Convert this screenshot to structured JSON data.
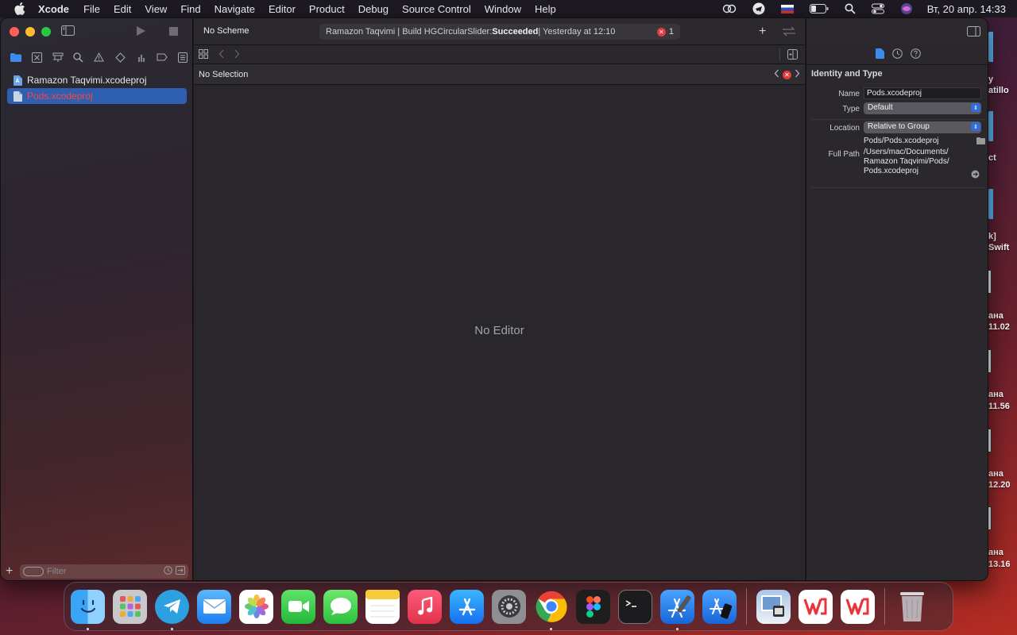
{
  "menubar": {
    "app": "Xcode",
    "items": [
      "File",
      "Edit",
      "View",
      "Find",
      "Navigate",
      "Editor",
      "Product",
      "Debug",
      "Source Control",
      "Window",
      "Help"
    ],
    "clock": "Вт, 20 апр.  14:33"
  },
  "desktop_labels": [
    "y",
    "atillo",
    "ct",
    "k]",
    "Swift",
    "ана",
    "11.02",
    "ана",
    "11.56",
    "ана",
    "12.20",
    "ана",
    "13.16"
  ],
  "navigator": {
    "items": [
      {
        "label": "Ramazon Taqvimi.xcodeproj"
      },
      {
        "label": "Pods.xcodeproj"
      }
    ],
    "filter_placeholder": "Filter"
  },
  "toolbar": {
    "scheme": "No Scheme",
    "activity_prefix": "Ramazon Taqvimi | Build HGCircularSlider: ",
    "activity_status": "Succeeded",
    "activity_time": " | Yesterday at 12:10",
    "error_count": "1"
  },
  "editor": {
    "jump_selection": "No Selection",
    "placeholder": "No Editor"
  },
  "inspector": {
    "section_title": "Identity and Type",
    "name_label": "Name",
    "name_value": "Pods.xcodeproj",
    "type_label": "Type",
    "type_value": "Default",
    "location_label": "Location",
    "location_value": "Relative to Group",
    "location_path": "Pods/Pods.xcodeproj",
    "fullpath_label": "Full Path",
    "fullpath_line1": "/Users/mac/Documents/",
    "fullpath_line2": "Ramazon Taqvimi/Pods/",
    "fullpath_line3": "Pods.xcodeproj"
  },
  "dock": {
    "apps": [
      "finder-icon",
      "launchpad-icon",
      "telegram-icon",
      "mail-icon",
      "photos-icon",
      "facetime-icon",
      "messages-icon",
      "notes-icon",
      "music-icon",
      "app-store-icon",
      "system-preferences-icon",
      "chrome-icon",
      "figma-icon",
      "terminal-icon",
      "xcode-icon",
      "simulator-icon",
      "preview-icon",
      "wps-icon",
      "wps-icon-2",
      "trash-icon"
    ]
  },
  "colors": {
    "accent": "#2e5fb0",
    "error": "#e33a3a",
    "missing_file": "#ff4640"
  }
}
